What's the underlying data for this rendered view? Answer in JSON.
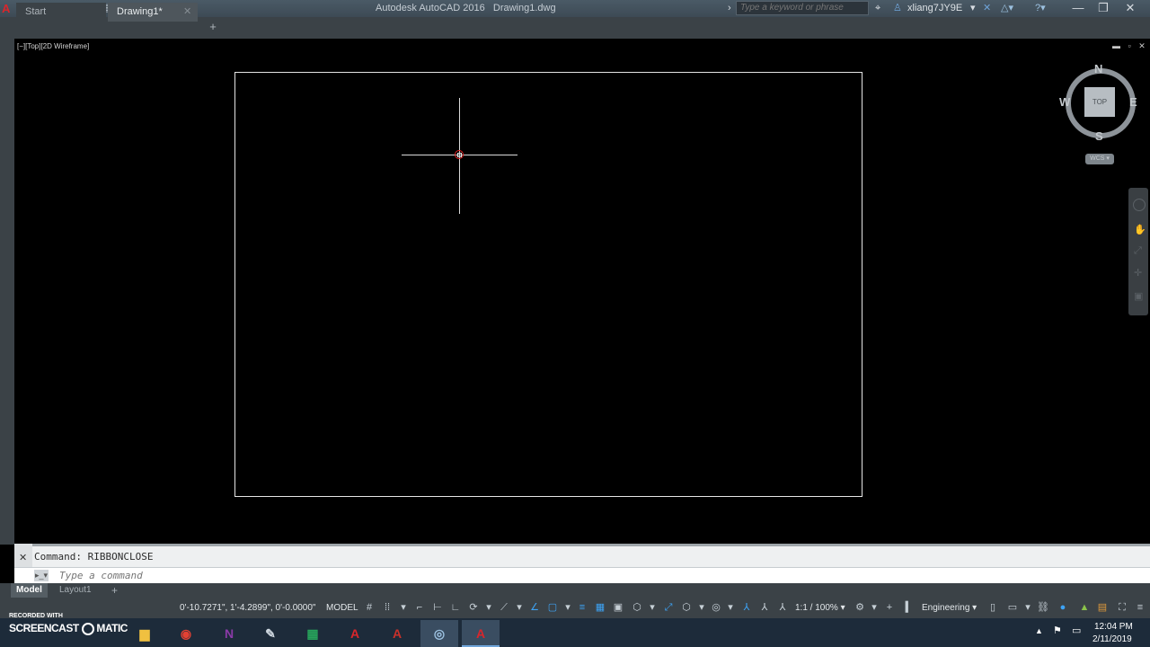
{
  "titlebar": {
    "app_title": "Autodesk AutoCAD 2016",
    "doc_title": "Drawing1.dwg",
    "search_placeholder": "Type a keyword or phrase",
    "user": "xliang7JY9E"
  },
  "tabs": [
    {
      "label": "Start"
    },
    {
      "label": "Drawing1*"
    }
  ],
  "viewport": {
    "label": "[−][Top][2D Wireframe]"
  },
  "viewcube": {
    "face": "TOP",
    "north": "N",
    "south": "S",
    "east": "E",
    "west": "W",
    "ucs": "WCS"
  },
  "command": {
    "history": "Command: RIBBONCLOSE",
    "input_placeholder": "Type a command"
  },
  "layout_tabs": [
    {
      "label": "Model"
    },
    {
      "label": "Layout1"
    }
  ],
  "status": {
    "coords": "0'-10.7271\", 1'-4.2899\", 0'-0.0000\"",
    "space": "MODEL",
    "scale": "1:1 / 100%",
    "workspace": "Engineering"
  },
  "taskbar": {
    "recorded_with": "RECORDED WITH",
    "screencast": "SCREENCAST",
    "matic": "MATIC",
    "time": "12:04 PM",
    "date": "2/11/2019"
  },
  "colors": {
    "accent": "#3da3f5",
    "autocad_red": "#c8102e"
  }
}
